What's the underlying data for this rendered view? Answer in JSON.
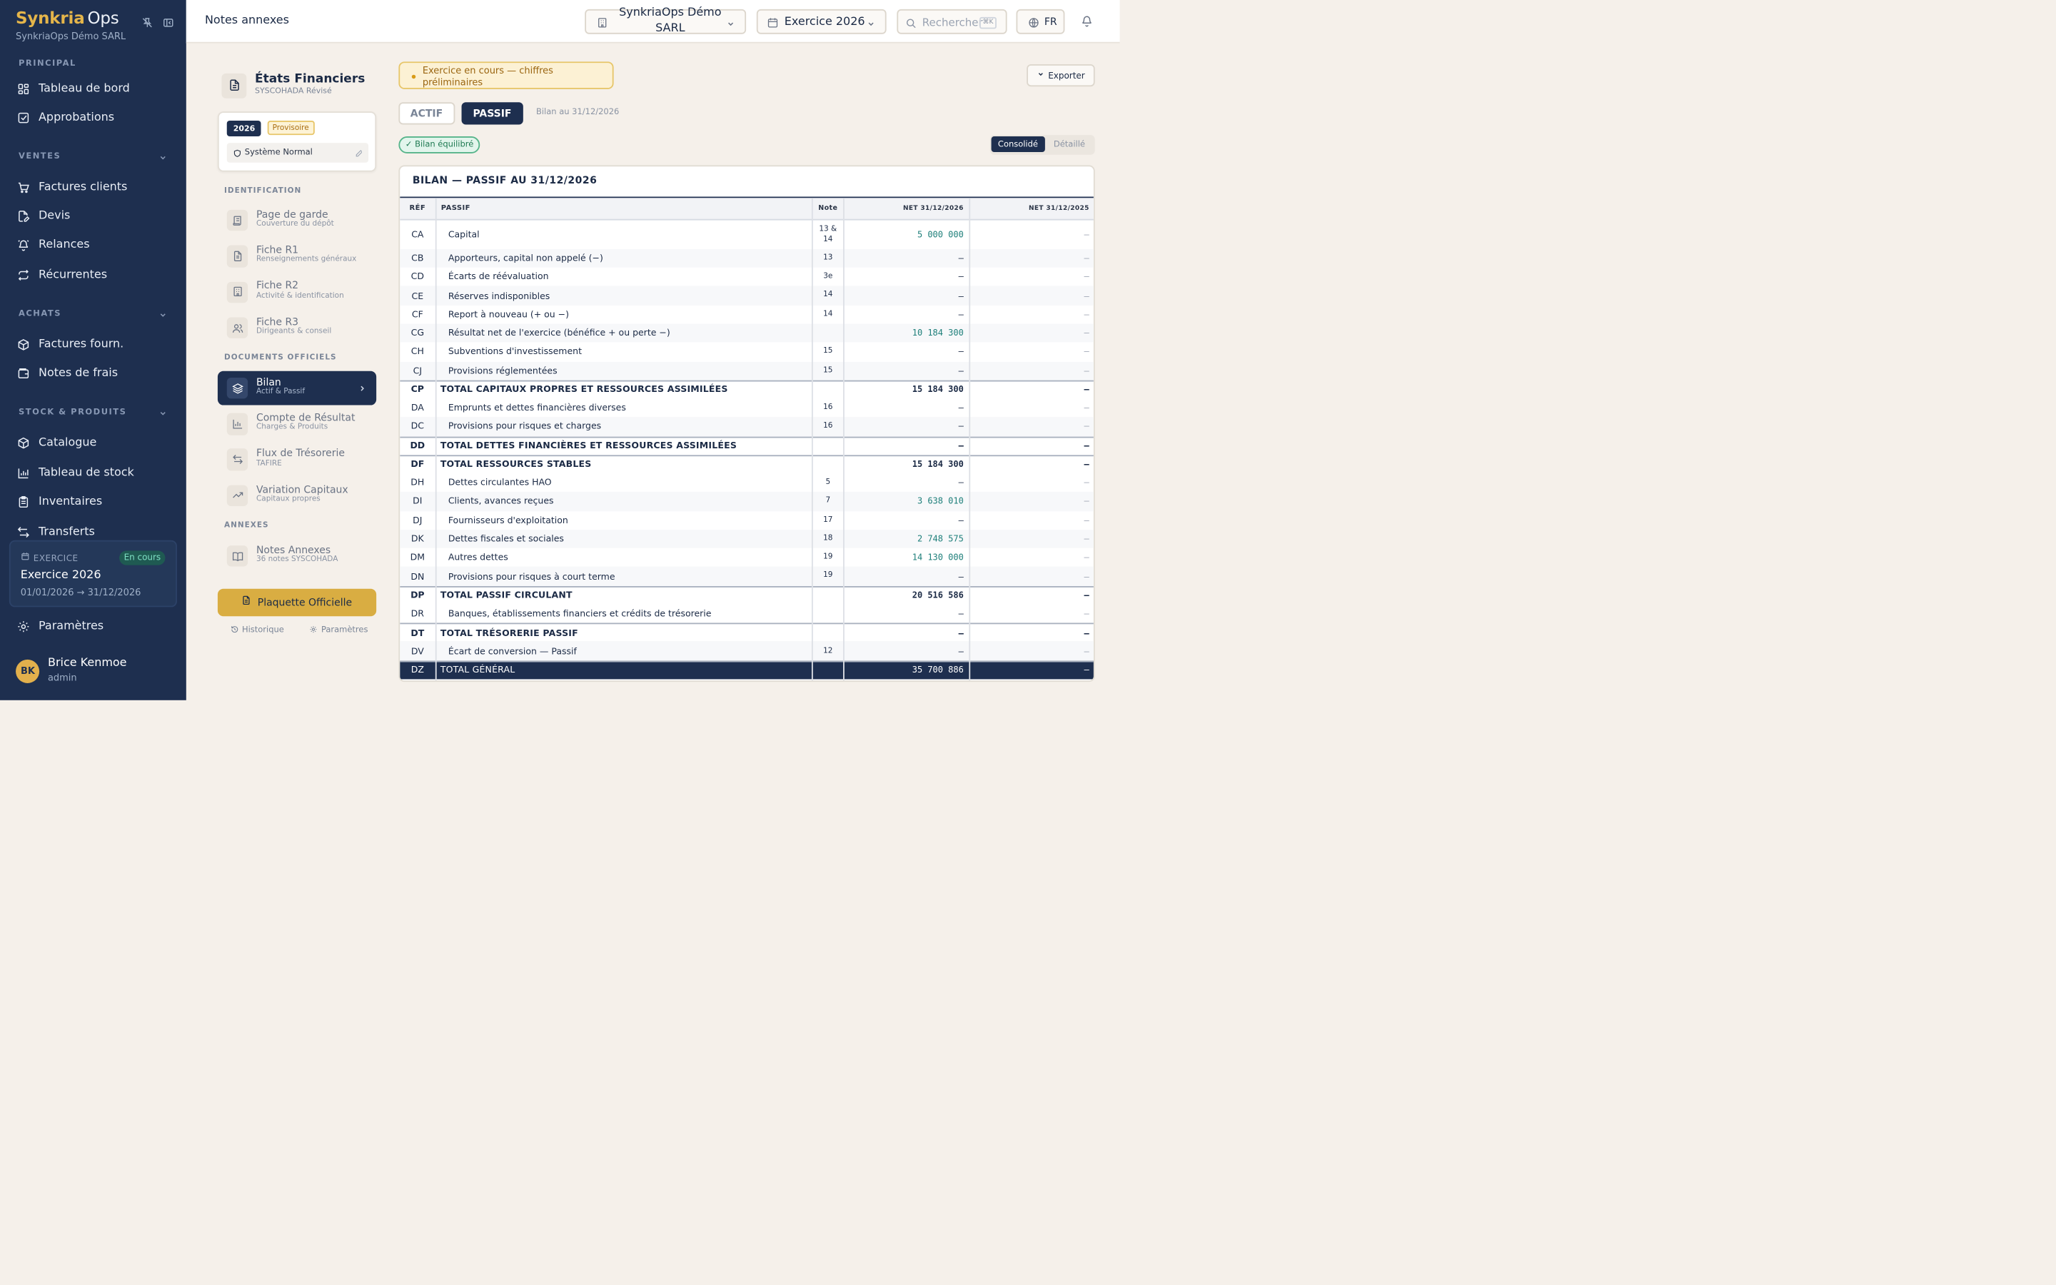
{
  "sidebar": {
    "brand_part1": "Synkria",
    "brand_part2": "Ops",
    "company": "SynkriaOps Démo SARL",
    "sections": {
      "principal": "PRINCIPAL",
      "ventes": "VENTES",
      "achats": "ACHATS",
      "stock": "STOCK & PRODUITS"
    },
    "items": {
      "dashboard": "Tableau de bord",
      "approbations": "Approbations",
      "factures_clients": "Factures clients",
      "devis": "Devis",
      "relances": "Relances",
      "recurrentes": "Récurrentes",
      "factures_fourn": "Factures fourn.",
      "notes_frais": "Notes de frais",
      "catalogue": "Catalogue",
      "tableau_stock": "Tableau de stock",
      "inventaires": "Inventaires",
      "transferts": "Transferts",
      "parametres": "Paramètres"
    },
    "exercice": {
      "label": "EXERCICE",
      "badge": "En cours",
      "title": "Exercice 2026",
      "range": "01/01/2026 → 31/12/2026"
    },
    "user": {
      "initials": "BK",
      "name": "Brice Kenmoe",
      "role": "admin"
    }
  },
  "topbar": {
    "title": "Notes annexes",
    "company_select": "SynkriaOps Démo SARL",
    "year_select": "Exercice 2026",
    "search_placeholder": "Rechercher",
    "search_shortcut": "⌘K",
    "lang": "FR"
  },
  "left_panel": {
    "title": "États Financiers",
    "subtitle": "SYSCOHADA Révisé",
    "year": "2026",
    "status": "Provisoire",
    "system": "Système Normal",
    "sections": {
      "identification": "IDENTIFICATION",
      "documents": "DOCUMENTS OFFICIELS",
      "annexes": "ANNEXES"
    },
    "docs": {
      "page_garde": {
        "title": "Page de garde",
        "sub": "Couverture du dépôt"
      },
      "r1": {
        "title": "Fiche R1",
        "sub": "Renseignements généraux"
      },
      "r2": {
        "title": "Fiche R2",
        "sub": "Activité & identification"
      },
      "r3": {
        "title": "Fiche R3",
        "sub": "Dirigeants & conseil"
      },
      "bilan": {
        "title": "Bilan",
        "sub": "Actif & Passif"
      },
      "resultat": {
        "title": "Compte de Résultat",
        "sub": "Charges & Produits"
      },
      "flux": {
        "title": "Flux de Trésorerie",
        "sub": "TAFIRE"
      },
      "variation": {
        "title": "Variation Capitaux",
        "sub": "Capitaux propres"
      },
      "notes": {
        "title": "Notes Annexes",
        "sub": "36 notes SYSCOHADA"
      }
    },
    "plaquette": "Plaquette Officielle",
    "historique": "Historique",
    "parametres": "Paramètres"
  },
  "main": {
    "warning": "Exercice en cours — chiffres préliminaires",
    "export": "Exporter",
    "tab_actif": "ACTIF",
    "tab_passif": "PASSIF",
    "bilan_date": "Bilan au 31/12/2026",
    "equilibre": "✓ Bilan équilibré",
    "view_consolide": "Consolidé",
    "view_detaille": "Détaillé",
    "table": {
      "title": "BILAN — PASSIF AU 31/12/2026",
      "headers": {
        "ref": "RÉF",
        "passif": "PASSIF",
        "note": "Note",
        "net_current": "NET 31/12/2026",
        "net_prev": "NET 31/12/2025"
      },
      "rows": [
        {
          "ref": "CA",
          "label": "Capital",
          "note": "13 & 14",
          "n1": "5 000 000",
          "n2": "–"
        },
        {
          "ref": "CB",
          "label": "Apporteurs, capital non appelé (−)",
          "note": "13",
          "n1": "–",
          "n2": "–"
        },
        {
          "ref": "CD",
          "label": "Écarts de réévaluation",
          "note": "3e",
          "n1": "–",
          "n2": "–"
        },
        {
          "ref": "CE",
          "label": "Réserves indisponibles",
          "note": "14",
          "n1": "–",
          "n2": "–"
        },
        {
          "ref": "CF",
          "label": "Report à nouveau (+ ou −)",
          "note": "14",
          "n1": "–",
          "n2": "–"
        },
        {
          "ref": "CG",
          "label": "Résultat net de l'exercice (bénéfice + ou perte −)",
          "note": "",
          "n1": "10 184 300",
          "n2": "–"
        },
        {
          "ref": "CH",
          "label": "Subventions d'investissement",
          "note": "15",
          "n1": "–",
          "n2": "–"
        },
        {
          "ref": "CJ",
          "label": "Provisions réglementées",
          "note": "15",
          "n1": "–",
          "n2": "–"
        },
        {
          "ref": "CP",
          "label": "TOTAL CAPITAUX PROPRES ET RESSOURCES ASSIMILÉES",
          "note": "",
          "n1": "15 184 300",
          "n2": "–"
        },
        {
          "ref": "DA",
          "label": "Emprunts et dettes financières diverses",
          "note": "16",
          "n1": "–",
          "n2": "–"
        },
        {
          "ref": "DC",
          "label": "Provisions pour risques et charges",
          "note": "16",
          "n1": "–",
          "n2": "–"
        },
        {
          "ref": "DD",
          "label": "TOTAL DETTES FINANCIÈRES ET RESSOURCES ASSIMILÉES",
          "note": "",
          "n1": "–",
          "n2": "–"
        },
        {
          "ref": "DF",
          "label": "TOTAL RESSOURCES STABLES",
          "note": "",
          "n1": "15 184 300",
          "n2": "–"
        },
        {
          "ref": "DH",
          "label": "Dettes circulantes HAO",
          "note": "5",
          "n1": "–",
          "n2": "–"
        },
        {
          "ref": "DI",
          "label": "Clients, avances reçues",
          "note": "7",
          "n1": "3 638 010",
          "n2": "–"
        },
        {
          "ref": "DJ",
          "label": "Fournisseurs d'exploitation",
          "note": "17",
          "n1": "–",
          "n2": "–"
        },
        {
          "ref": "DK",
          "label": "Dettes fiscales et sociales",
          "note": "18",
          "n1": "2 748 575",
          "n2": "–"
        },
        {
          "ref": "DM",
          "label": "Autres dettes",
          "note": "19",
          "n1": "14 130 000",
          "n2": "–"
        },
        {
          "ref": "DN",
          "label": "Provisions pour risques à court terme",
          "note": "19",
          "n1": "–",
          "n2": "–"
        },
        {
          "ref": "DP",
          "label": "TOTAL PASSIF CIRCULANT",
          "note": "",
          "n1": "20 516 586",
          "n2": "–"
        },
        {
          "ref": "DR",
          "label": "Banques, établissements financiers et crédits de trésorerie",
          "note": "",
          "n1": "–",
          "n2": "–"
        },
        {
          "ref": "DT",
          "label": "TOTAL TRÉSORERIE PASSIF",
          "note": "",
          "n1": "–",
          "n2": "–"
        },
        {
          "ref": "DV",
          "label": "Écart de conversion — Passif",
          "note": "12",
          "n1": "–",
          "n2": "–"
        },
        {
          "ref": "DZ",
          "label": "TOTAL GÉNÉRAL",
          "note": "",
          "n1": "35 700 886",
          "n2": "–"
        }
      ]
    }
  }
}
